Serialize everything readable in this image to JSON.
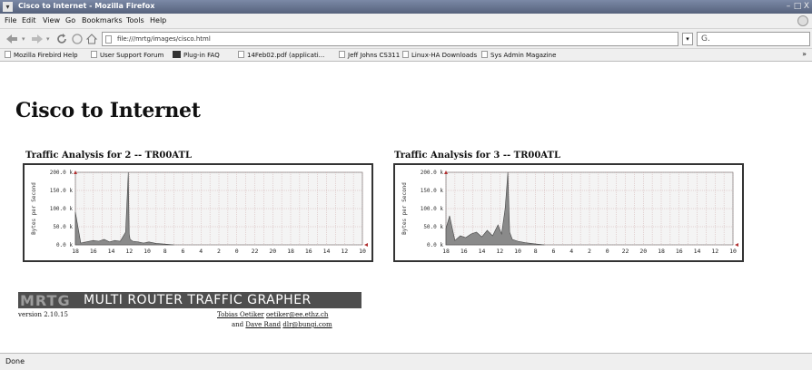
{
  "window": {
    "title": "Cisco to Internet - Mozilla Firefox",
    "sys_icon": "▾",
    "minimize": "–",
    "maximize": "□",
    "close": "X"
  },
  "menubar": {
    "items": [
      "File",
      "Edit",
      "View",
      "Go",
      "Bookmarks",
      "Tools",
      "Help"
    ]
  },
  "navigation": {
    "back_icon": "left-arrow-icon",
    "forward_icon": "right-arrow-icon",
    "reload_icon": "reload-icon",
    "stop_icon": "stop-icon",
    "home_icon": "home-icon",
    "url": "file:///mrtg/images/cisco.html",
    "search_value": "",
    "search_glyph": "G."
  },
  "bookmarks": [
    "Mozilla Firebird Help",
    "User Support Forum",
    "Plug-in FAQ",
    "14Feb02.pdf (applicati...",
    "Jeff Johns CS311",
    "Linux-HA Downloads",
    "Sys Admin Magazine"
  ],
  "bookmarks_more": "»",
  "page": {
    "title": "Cisco to Internet",
    "logo_word": "MRTG",
    "logo_full": "MULTI ROUTER TRAFFIC GRAPHER",
    "version": "version 2.10.15",
    "credit_line1_name": "Tobias Oetiker",
    "credit_line1_email": "oetiker@ee.ethz.ch",
    "credit_line2_prefix": "and",
    "credit_line2_name": "Dave Rand",
    "credit_line2_email": "dlr@bungi.com"
  },
  "status": "Done",
  "chart_data": [
    {
      "type": "area",
      "title": "Traffic Analysis for 2 -- TR00ATL",
      "ylabel": "Bytes per Second",
      "yticks": [
        "200.0 k",
        "150.0 k",
        "100.0 k",
        "50.0 k",
        "0.0 k"
      ],
      "ylim": [
        0,
        200
      ],
      "xticks": [
        "18",
        "16",
        "14",
        "12",
        "10",
        "8",
        "6",
        "4",
        "2",
        "0",
        "22",
        "20",
        "18",
        "16",
        "14",
        "12",
        "10"
      ],
      "grid": true,
      "series": [
        {
          "x": [
            0,
            0.3,
            0.6,
            1.0,
            1.3,
            1.6,
            1.9,
            2.2,
            2.5,
            2.8,
            2.95,
            3.0,
            3.05,
            3.2,
            3.5,
            3.8,
            4.1,
            4.5,
            5.0,
            5.5
          ],
          "values": [
            90,
            5,
            8,
            12,
            10,
            15,
            8,
            12,
            10,
            35,
            200,
            30,
            15,
            10,
            8,
            5,
            8,
            4,
            2,
            0
          ]
        }
      ]
    },
    {
      "type": "area",
      "title": "Traffic Analysis for 3 -- TR00ATL",
      "ylabel": "Bytes per Second",
      "yticks": [
        "200.0 k",
        "150.0 k",
        "100.0 k",
        "50.0 k",
        "0.0 k"
      ],
      "ylim": [
        0,
        200
      ],
      "xticks": [
        "18",
        "16",
        "14",
        "12",
        "10",
        "8",
        "6",
        "4",
        "2",
        "0",
        "22",
        "20",
        "18",
        "16",
        "14",
        "12",
        "10"
      ],
      "grid": true,
      "series": [
        {
          "x": [
            0,
            0.2,
            0.5,
            0.8,
            1.1,
            1.4,
            1.7,
            2.0,
            2.3,
            2.6,
            2.9,
            3.1,
            3.3,
            3.45,
            3.55,
            3.7,
            4.0,
            4.4,
            4.9,
            5.5
          ],
          "values": [
            45,
            80,
            12,
            25,
            20,
            30,
            35,
            22,
            40,
            25,
            55,
            30,
            100,
            200,
            35,
            15,
            10,
            6,
            3,
            0
          ]
        }
      ]
    }
  ]
}
